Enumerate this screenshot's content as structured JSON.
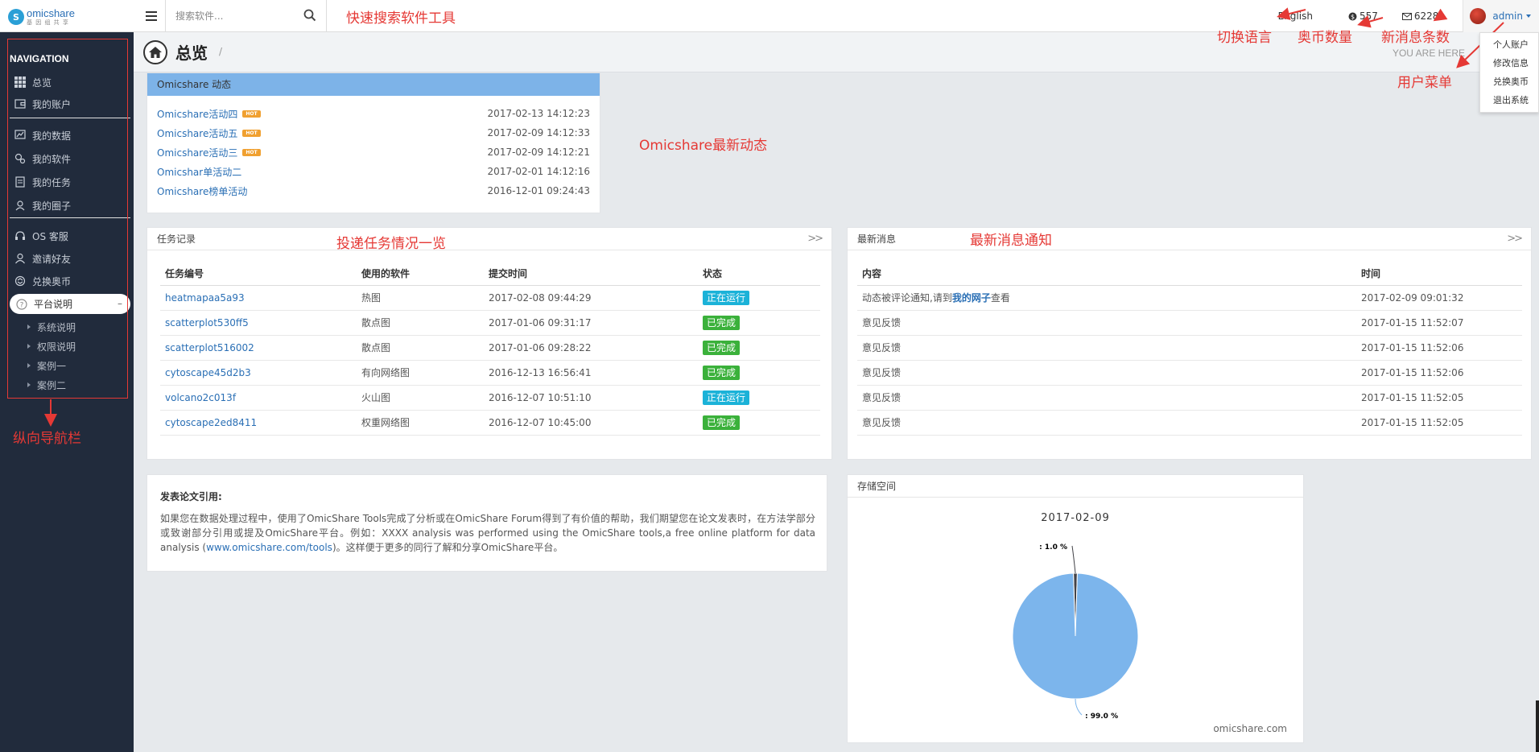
{
  "header": {
    "logo_name": "omicshare",
    "logo_sub": "基 因 组 共 享",
    "search_placeholder": "搜索软件...",
    "language": "English",
    "coins": "557",
    "messages": "6228",
    "user": "admin",
    "user_menu": [
      "个人账户",
      "修改信息",
      "兑换奥币",
      "退出系统"
    ]
  },
  "sidebar": {
    "title": "NAVIGATION",
    "group1": [
      "总览",
      "我的账户"
    ],
    "group2": [
      "我的数据",
      "我的软件",
      "我的任务",
      "我的圈子"
    ],
    "group3": [
      "OS 客服",
      "邀请好友",
      "兑换奥币"
    ],
    "active": "平台说明",
    "sub_items": [
      "系统说明",
      "权限说明",
      "案例一",
      "案例二"
    ]
  },
  "breadcrumb": {
    "title": "总览",
    "slash": "/",
    "you_are_here": "YOU ARE HERE"
  },
  "news": {
    "title": "Omicshare 动态",
    "hot_label": "HOT",
    "items": [
      {
        "title": "Omicshare活动四",
        "hot": true,
        "date": "2017-02-13 14:12:23"
      },
      {
        "title": "Omicshare活动五",
        "hot": true,
        "date": "2017-02-09 14:12:33"
      },
      {
        "title": "Omicshare活动三",
        "hot": true,
        "date": "2017-02-09 14:12:21"
      },
      {
        "title": "Omicshar单活动二",
        "hot": false,
        "date": "2017-02-01 14:12:16"
      },
      {
        "title": "Omicshare榜单活动",
        "hot": false,
        "date": "2016-12-01 09:24:43"
      }
    ]
  },
  "tasks": {
    "title": "任务记录",
    "more": ">>",
    "columns": [
      "任务编号",
      "使用的软件",
      "提交时间",
      "状态"
    ],
    "rows": [
      {
        "id": "heatmapaa5a93",
        "software": "热图",
        "time": "2017-02-08 09:44:29",
        "status": "正在运行",
        "kind": "run"
      },
      {
        "id": "scatterplot530ff5",
        "software": "散点图",
        "time": "2017-01-06 09:31:17",
        "status": "已完成",
        "kind": "done"
      },
      {
        "id": "scatterplot516002",
        "software": "散点图",
        "time": "2017-01-06 09:28:22",
        "status": "已完成",
        "kind": "done"
      },
      {
        "id": "cytoscape45d2b3",
        "software": "有向网络图",
        "time": "2016-12-13 16:56:41",
        "status": "已完成",
        "kind": "done"
      },
      {
        "id": "volcano2c013f",
        "software": "火山图",
        "time": "2016-12-07 10:51:10",
        "status": "正在运行",
        "kind": "run"
      },
      {
        "id": "cytoscape2ed8411",
        "software": "权重网络图",
        "time": "2016-12-07 10:45:00",
        "status": "已完成",
        "kind": "done"
      }
    ]
  },
  "messages": {
    "title": "最新消息",
    "more": ">>",
    "columns": [
      "内容",
      "时间"
    ],
    "first_prefix": "动态被评论通知,请到",
    "first_link": "我的网子",
    "first_suffix": "查看",
    "rows": [
      {
        "content": "",
        "time": "2017-02-09 09:01:32"
      },
      {
        "content": "意见反馈",
        "time": "2017-01-15 11:52:07"
      },
      {
        "content": "意见反馈",
        "time": "2017-01-15 11:52:06"
      },
      {
        "content": "意见反馈",
        "time": "2017-01-15 11:52:06"
      },
      {
        "content": "意见反馈",
        "time": "2017-01-15 11:52:05"
      },
      {
        "content": "意见反馈",
        "time": "2017-01-15 11:52:05"
      }
    ]
  },
  "citation": {
    "title": "发表论文引用:",
    "body": "如果您在数据处理过程中，使用了OmicShare Tools完成了分析或在OmicShare Forum得到了有价值的帮助，我们期望您在论文发表时，在方法学部分或致谢部分引用或提及OmicShare平台。例如：XXXX analysis was performed using the OmicShare tools,a free online platform for data analysis (",
    "link": "www.omicshare.com/tools",
    "tail": ")。这样便于更多的同行了解和分享OmicShare平台。"
  },
  "storage": {
    "title": "存储空间",
    "credit": "omicshare.com"
  },
  "chart_data": {
    "type": "pie",
    "title": "2017-02-09",
    "slices": [
      {
        "label": ": 99.0 %",
        "value": 99.0,
        "color": "#7cb5ec"
      },
      {
        "label": ": 1.0 %",
        "value": 1.0,
        "color": "#434348"
      }
    ]
  },
  "annotations": {
    "search": "快速搜索软件工具",
    "language": "切换语言",
    "coins": "奥币数量",
    "messages": "新消息条数",
    "user_menu": "用户菜单",
    "news": "Omicshare最新动态",
    "tasks": "投递任务情况一览",
    "msgs": "最新消息通知",
    "nav": "纵向导航栏"
  },
  "colors": {
    "sidebar": "#212b3c",
    "accent": "#2a6fb5",
    "running": "#1bb2d8",
    "done": "#3bb13b",
    "annotation": "#e53935"
  }
}
